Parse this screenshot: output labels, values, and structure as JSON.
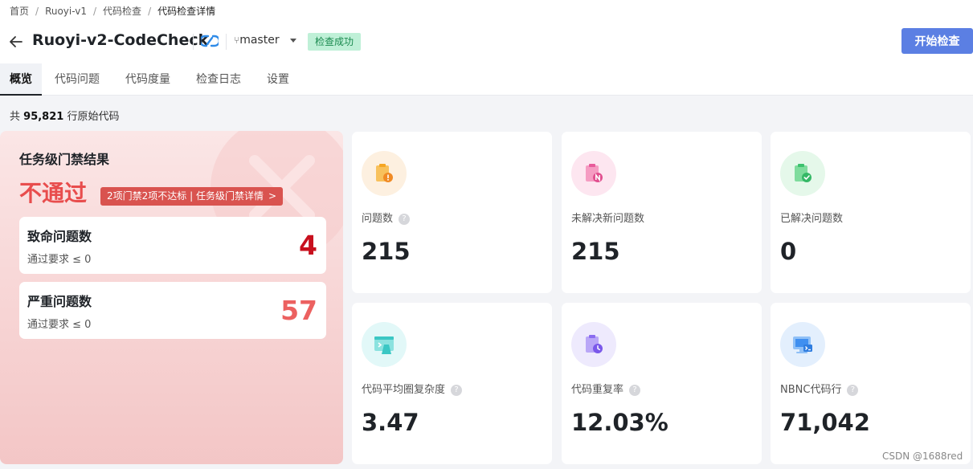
{
  "breadcrumb": [
    "首页",
    "Ruoyi-v1",
    "代码检查",
    "代码检查详情"
  ],
  "header": {
    "title": "Ruoyi-v2-CodeCheck",
    "branch": "master",
    "status_badge": "检查成功",
    "start_button": "开始检查"
  },
  "tabs": [
    {
      "label": "概览",
      "active": true
    },
    {
      "label": "代码问题",
      "active": false
    },
    {
      "label": "代码度量",
      "active": false
    },
    {
      "label": "检查日志",
      "active": false
    },
    {
      "label": "设置",
      "active": false
    }
  ],
  "summary": {
    "prefix": "共",
    "lines": "95,821",
    "suffix": "行原始代码"
  },
  "gate": {
    "title": "任务级门禁结果",
    "status": "不通过",
    "detail_link": "2项门禁2项不达标 | 任务级门禁详情",
    "detail_arrow": ">",
    "items": [
      {
        "label": "致命问题数",
        "requirement": "通过要求 ≤ 0",
        "value": "4",
        "color": "#c8101e"
      },
      {
        "label": "严重问题数",
        "requirement": "通过要求 ≤ 0",
        "value": "57",
        "color": "#ec6160"
      }
    ]
  },
  "metrics": [
    {
      "label": "问题数",
      "value": "215",
      "help": true,
      "icon": "clipboard-warning-icon",
      "icon_color": "#f5a623",
      "icon_bg": "#fdf0e0"
    },
    {
      "label": "未解决新问题数",
      "value": "215",
      "help": false,
      "icon": "clipboard-new-icon",
      "icon_color": "#e85b9b",
      "icon_bg": "#fde6f0"
    },
    {
      "label": "已解决问题数",
      "value": "0",
      "help": false,
      "icon": "clipboard-check-icon",
      "icon_color": "#3cc26e",
      "icon_bg": "#e5f8ea"
    },
    {
      "label": "代码平均圈复杂度",
      "value": "3.47",
      "help": true,
      "icon": "code-complexity-icon",
      "icon_color": "#3bc7c4",
      "icon_bg": "#e2f8f8"
    },
    {
      "label": "代码重复率",
      "value": "12.03%",
      "help": true,
      "icon": "clipboard-clock-icon",
      "icon_color": "#8b6cf0",
      "icon_bg": "#eeeafd"
    },
    {
      "label": "NBNC代码行",
      "value": "71,042",
      "help": true,
      "icon": "terminal-window-icon",
      "icon_color": "#3f8ff0",
      "icon_bg": "#e3effd"
    }
  ],
  "watermark": "CSDN @1688red"
}
